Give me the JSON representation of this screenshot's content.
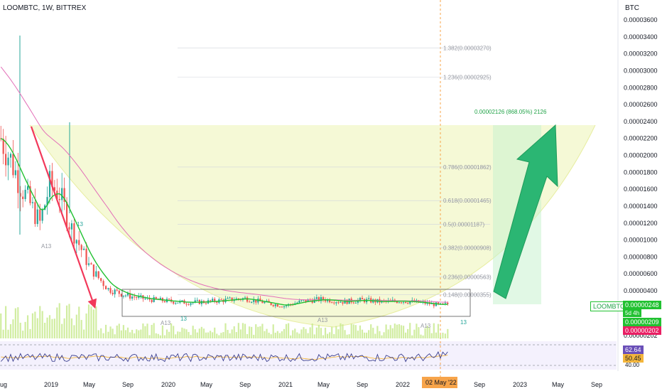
{
  "header": {
    "title": "LOOMBTC, 1W, BITTREX"
  },
  "axis_unit": "BTC",
  "price_axis": {
    "ticks": [
      "0.00003600",
      "0.00003400",
      "0.00003200",
      "0.00003000",
      "0.00002800",
      "0.00002600",
      "0.00002400",
      "0.00002200",
      "0.00002000",
      "0.00001800",
      "0.00001600",
      "0.00001400",
      "0.00001200",
      "0.00001000",
      "0.00000800",
      "0.00000600",
      "0.00000400",
      "0.00000202"
    ]
  },
  "time_axis": {
    "ticks": [
      "ug",
      "2019",
      "May",
      "Sep",
      "2020",
      "May",
      "Sep",
      "2021",
      "May",
      "Sep",
      "2022",
      "02 May '22",
      "Sep",
      "2023",
      "May",
      "Sep"
    ]
  },
  "badges": {
    "symbol": "LOOMBTC",
    "last_price": "0.00000248",
    "countdown": "5d 4h",
    "price2": "0.00000209",
    "price3": "0.00000202",
    "rsi1": "62.64",
    "rsi2": "50.45",
    "rsi_level": "40.00"
  },
  "fib_levels": [
    {
      "label": "1.382(0.00003270)",
      "value": 3.27e-05
    },
    {
      "label": "1.236(0.00002925)",
      "value": 2.925e-05
    },
    {
      "label": "0.786(0.00001862)",
      "value": 1.862e-05
    },
    {
      "label": "0.618(0.00001465)",
      "value": 1.465e-05,
      "highlight": true
    },
    {
      "label": "0.5(0.00001187)",
      "value": 1.187e-05
    },
    {
      "label": "0.382(0.00000908)",
      "value": 9.08e-06
    },
    {
      "label": "0.236(0.00000563)",
      "value": 5.63e-06
    },
    {
      "label": "0.148(0.00000355)",
      "value": 3.55e-06
    }
  ],
  "target_label": "0.00002126 (868.05%) 2126",
  "td_labels": [
    "A13",
    "A13",
    "13",
    "A13",
    "A13",
    "13"
  ],
  "colors": {
    "up": "#26a69a",
    "down": "#ef5350",
    "ema_fast": "#21c131",
    "ema_slow": "#e36fb8",
    "arrow_green": "#2bb673",
    "arrow_red": "#f2385a",
    "cup": "#f2f7c8",
    "rsi": "#3b3f8f"
  },
  "chart_data": {
    "type": "candlestick",
    "symbol": "LOOMBTC",
    "interval": "1W",
    "exchange": "BITTREX",
    "y_unit": "BTC",
    "ylim": [
      2.02e-06,
      3.66e-05
    ],
    "x_range": [
      "2018-08",
      "2023-10"
    ],
    "price_path": [
      {
        "x": "2018-08",
        "y": 2.2e-05
      },
      {
        "x": "2018-09",
        "y": 1.95e-05
      },
      {
        "x": "2018-10",
        "y": 1.65e-05
      },
      {
        "x": "2018-11",
        "y": 1.42e-05
      },
      {
        "x": "2018-12",
        "y": 1.2e-05
      },
      {
        "x": "2019-01",
        "y": 1.65e-05
      },
      {
        "x": "2019-02",
        "y": 1.55e-05
      },
      {
        "x": "2019-03",
        "y": 1.2e-05
      },
      {
        "x": "2019-04",
        "y": 9.5e-06
      },
      {
        "x": "2019-05",
        "y": 7e-06
      },
      {
        "x": "2019-06",
        "y": 5.5e-06
      },
      {
        "x": "2019-07",
        "y": 4.2e-06
      },
      {
        "x": "2019-09",
        "y": 3.4e-06
      },
      {
        "x": "2019-11",
        "y": 3e-06
      },
      {
        "x": "2020-01",
        "y": 2.8e-06
      },
      {
        "x": "2020-03",
        "y": 2.6e-06
      },
      {
        "x": "2020-05",
        "y": 2.7e-06
      },
      {
        "x": "2020-07",
        "y": 2.9e-06
      },
      {
        "x": "2020-09",
        "y": 3.1e-06
      },
      {
        "x": "2020-11",
        "y": 2.6e-06
      },
      {
        "x": "2021-01",
        "y": 2.2e-06
      },
      {
        "x": "2021-03",
        "y": 2.8e-06
      },
      {
        "x": "2021-05",
        "y": 3e-06
      },
      {
        "x": "2021-07",
        "y": 2.7e-06
      },
      {
        "x": "2021-09",
        "y": 2.9e-06
      },
      {
        "x": "2021-11",
        "y": 2.7e-06
      },
      {
        "x": "2022-01",
        "y": 2.8e-06
      },
      {
        "x": "2022-03",
        "y": 2.6e-06
      },
      {
        "x": "2022-05",
        "y": 2.3e-06
      },
      {
        "x": "2022-06",
        "y": 2.5e-06
      }
    ],
    "rsi": {
      "last": 62.64,
      "signal": 50.45,
      "level": 40.0
    },
    "projection": {
      "target": 2.126e-05,
      "gain_pct": 868.05
    }
  }
}
